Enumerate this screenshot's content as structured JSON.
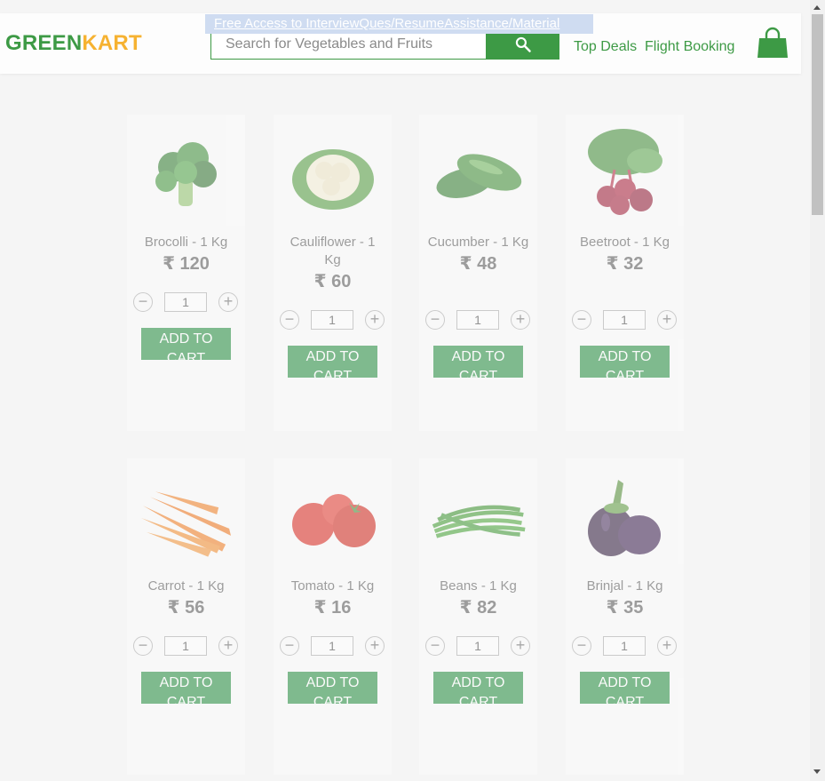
{
  "banner": {
    "text": "Free Access to InterviewQues/ResumeAssistance/Material"
  },
  "header": {
    "brand_part1": "GREEN",
    "brand_part2": "KART",
    "search_placeholder": "Search for Vegetables and Fruits",
    "nav": [
      "Top Deals",
      "Flight Booking"
    ]
  },
  "colors": {
    "brand_green": "#3d9a45",
    "brand_orange": "#f6b231",
    "button_green": "#1f8a3a"
  },
  "products": [
    {
      "name": "Brocolli - 1 Kg",
      "price": "₹ 120",
      "qty": "1",
      "button": "ADD TO CART",
      "icon": "broccoli-image"
    },
    {
      "name": "Cauliflower - 1 Kg",
      "price": "₹ 60",
      "qty": "1",
      "button": "ADD TO CART",
      "icon": "cauliflower-image"
    },
    {
      "name": "Cucumber - 1 Kg",
      "price": "₹ 48",
      "qty": "1",
      "button": "ADD TO CART",
      "icon": "cucumber-image"
    },
    {
      "name": "Beetroot - 1 Kg",
      "price": "₹ 32",
      "qty": "1",
      "button": "ADD TO CART",
      "icon": "beetroot-image"
    },
    {
      "name": "Carrot - 1 Kg",
      "price": "₹ 56",
      "qty": "1",
      "button": "ADD TO CART",
      "icon": "carrot-image"
    },
    {
      "name": "Tomato - 1 Kg",
      "price": "₹ 16",
      "qty": "1",
      "button": "ADD TO CART",
      "icon": "tomato-image"
    },
    {
      "name": "Beans - 1 Kg",
      "price": "₹ 82",
      "qty": "1",
      "button": "ADD TO CART",
      "icon": "beans-image"
    },
    {
      "name": "Brinjal - 1 Kg",
      "price": "₹ 35",
      "qty": "1",
      "button": "ADD TO CART",
      "icon": "brinjal-image"
    }
  ]
}
